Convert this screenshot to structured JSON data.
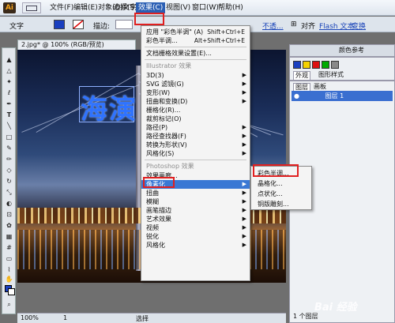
{
  "app": {
    "icon_label": "Ai"
  },
  "menubar": {
    "items": [
      "文件(F)",
      "编辑(E)",
      "对象(O)",
      "文字(T)",
      "选择(S)",
      "效果(C)",
      "视图(V)",
      "窗口(W)",
      "帮助(H)"
    ]
  },
  "controlbar": {
    "type_label": "文字",
    "stroke_label": "描边:",
    "opacity_link": "不透...",
    "align_label": "对齐",
    "flash_text": "Flash 文本",
    "transform_label": "变换",
    "fill_color": "#1a3fbf"
  },
  "document": {
    "tab_title": "2.jpg* @ 100% (RGB/预览)",
    "canvas_text": "海演"
  },
  "effects_menu": {
    "items": [
      {
        "label": "应用 \"彩色半调\" (A)",
        "shortcut": "Shift+Ctrl+E"
      },
      {
        "label": "彩色半调...",
        "shortcut": "Alt+Shift+Ctrl+E"
      },
      {
        "label": "文档栅格效果设置(E)..."
      },
      {
        "label": "Illustrator 效果",
        "disabled": true
      },
      {
        "label": "3D(3)",
        "submenu": true
      },
      {
        "label": "SVG 滤镜(G)",
        "submenu": true
      },
      {
        "label": "变形(W)",
        "submenu": true
      },
      {
        "label": "扭曲和变换(D)",
        "submenu": true
      },
      {
        "label": "栅格化(R)..."
      },
      {
        "label": "裁剪标记(O)"
      },
      {
        "label": "路径(P)",
        "submenu": true
      },
      {
        "label": "路径查找器(F)",
        "submenu": true
      },
      {
        "label": "转换为形状(V)",
        "submenu": true
      },
      {
        "label": "风格化(S)",
        "submenu": true
      },
      {
        "label": "Photoshop 效果",
        "disabled": true
      },
      {
        "label": "效果画廊..."
      },
      {
        "label": "像素化",
        "submenu": true,
        "highlighted": true
      },
      {
        "label": "扭曲",
        "submenu": true
      },
      {
        "label": "模糊",
        "submenu": true
      },
      {
        "label": "画笔描边",
        "submenu": true
      },
      {
        "label": "素描",
        "submenu": true
      },
      {
        "label": "纹理",
        "submenu": true
      },
      {
        "label": "艺术效果",
        "submenu": true
      },
      {
        "label": "视频",
        "submenu": true
      },
      {
        "label": "锐化",
        "submenu": true
      },
      {
        "label": "风格化",
        "submenu": true
      }
    ]
  },
  "pixelate_submenu": {
    "items": [
      "彩色半调...",
      "晶格化...",
      "点状化...",
      "铜版雕刻..."
    ]
  },
  "panels": {
    "swatch_tab_left": "外观",
    "swatch_tab_right": "图形样式",
    "color_ref": "颜色参考",
    "layers_tab": "图层",
    "artboards_tab": "画板",
    "layer_name": "图层 1",
    "layer_count": "1 个图层"
  },
  "status": {
    "zoom": "100%",
    "page": "1",
    "mode": "选择"
  },
  "watermark": "Bai 经验",
  "colors": {
    "menu_highlight": "#3a78d4",
    "annotation": "#e02020"
  }
}
